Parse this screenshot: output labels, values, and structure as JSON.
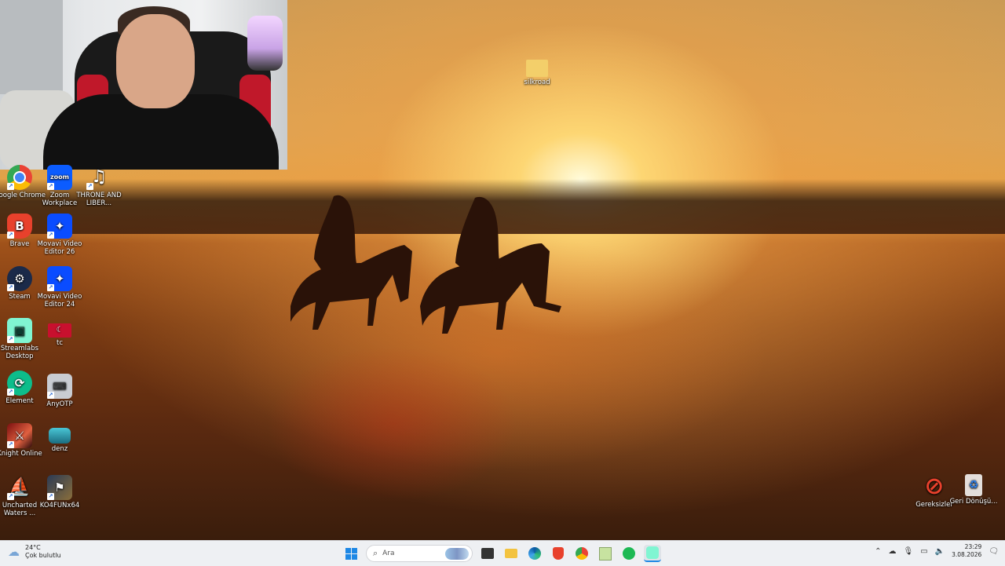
{
  "desktop": {
    "folder_label": "silkroad",
    "icons_col1": [
      {
        "id": "chrome",
        "label": "Google Chrome"
      },
      {
        "id": "brave",
        "label": "Brave"
      },
      {
        "id": "steam",
        "label": "Steam"
      },
      {
        "id": "streamlabs",
        "label": "Streamlabs Desktop"
      },
      {
        "id": "element",
        "label": "Element"
      },
      {
        "id": "knight",
        "label": "Knight Online"
      },
      {
        "id": "uncharted",
        "label": "Uncharted Waters ..."
      }
    ],
    "icons_col2": [
      {
        "id": "zoom",
        "label": "Zoom Workplace"
      },
      {
        "id": "movavi26",
        "label": "Movavi Video Editor 26"
      },
      {
        "id": "movavi24",
        "label": "Movavi Video Editor 24"
      },
      {
        "id": "tc",
        "label": "tc"
      },
      {
        "id": "anyotp",
        "label": "AnyOTP"
      },
      {
        "id": "denz",
        "label": "denz"
      },
      {
        "id": "ko4fun",
        "label": "KO4FUNx64"
      }
    ],
    "icons_col3": [
      {
        "id": "throne",
        "label": "THRONE AND LIBER..."
      }
    ],
    "right_icons": [
      {
        "id": "gereksizler",
        "label": "Gereksizler"
      },
      {
        "id": "recycle",
        "label": "Geri Dönüşü..."
      }
    ]
  },
  "taskbar": {
    "weather_temp": "24°C",
    "weather_desc": "Çok bulutlu",
    "search_placeholder": "Ara",
    "clock_time": "23:29",
    "clock_date": "3.08.2026"
  },
  "colors": {
    "taskbar_bg": "#eef0f3",
    "chrome": "#ffffff",
    "brave": "#e8412c",
    "steam": "#1b2a49",
    "streamlabs": "#80f5d2",
    "element": "#0dbd8b",
    "movavi": "#0a4cff",
    "zoom": "#0b5cff"
  }
}
